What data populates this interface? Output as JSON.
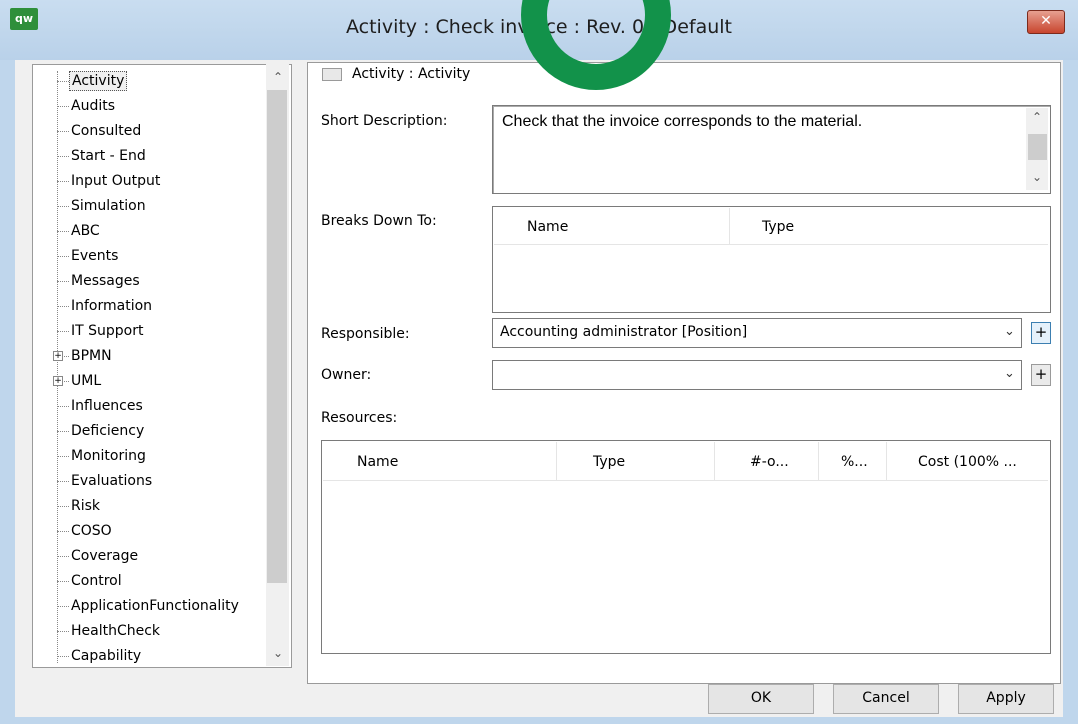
{
  "window": {
    "app_icon_label": "qw",
    "title": "Activity : Check invoice : Rev. 0  : Default",
    "close_label": "✕"
  },
  "tree": {
    "items": [
      {
        "label": "Activity",
        "selected": true
      },
      {
        "label": "Audits"
      },
      {
        "label": "Consulted"
      },
      {
        "label": "Start - End"
      },
      {
        "label": "Input Output"
      },
      {
        "label": "Simulation"
      },
      {
        "label": "ABC"
      },
      {
        "label": "Events"
      },
      {
        "label": "Messages"
      },
      {
        "label": "Information"
      },
      {
        "label": "IT Support"
      },
      {
        "label": "BPMN",
        "expandable": true
      },
      {
        "label": "UML",
        "expandable": true
      },
      {
        "label": "Influences"
      },
      {
        "label": "Deficiency"
      },
      {
        "label": "Monitoring"
      },
      {
        "label": "Evaluations"
      },
      {
        "label": "Risk"
      },
      {
        "label": "COSO"
      },
      {
        "label": "Coverage"
      },
      {
        "label": "Control"
      },
      {
        "label": "ApplicationFunctionality"
      },
      {
        "label": "HealthCheck"
      },
      {
        "label": "Capability"
      }
    ]
  },
  "panel": {
    "header_label": "Activity : Activity",
    "short_description_label": "Short Description:",
    "short_description_value": "Check that the invoice corresponds to the material.",
    "breaks_down_label": "Breaks Down To:",
    "breaks_down_columns": [
      "Name",
      "Type"
    ],
    "responsible_label": "Responsible:",
    "responsible_value": "Accounting administrator [Position]",
    "owner_label": "Owner:",
    "owner_value": "",
    "resources_label": "Resources:",
    "resources_columns": [
      "Name",
      "Type",
      "#-o...",
      "%...",
      "Cost (100% ..."
    ],
    "plus_label": "+"
  },
  "buttons": {
    "ok": "OK",
    "cancel": "Cancel",
    "apply": "Apply"
  },
  "colors": {
    "overlay_ring": "#12924a",
    "close_button": "#c8452e"
  }
}
